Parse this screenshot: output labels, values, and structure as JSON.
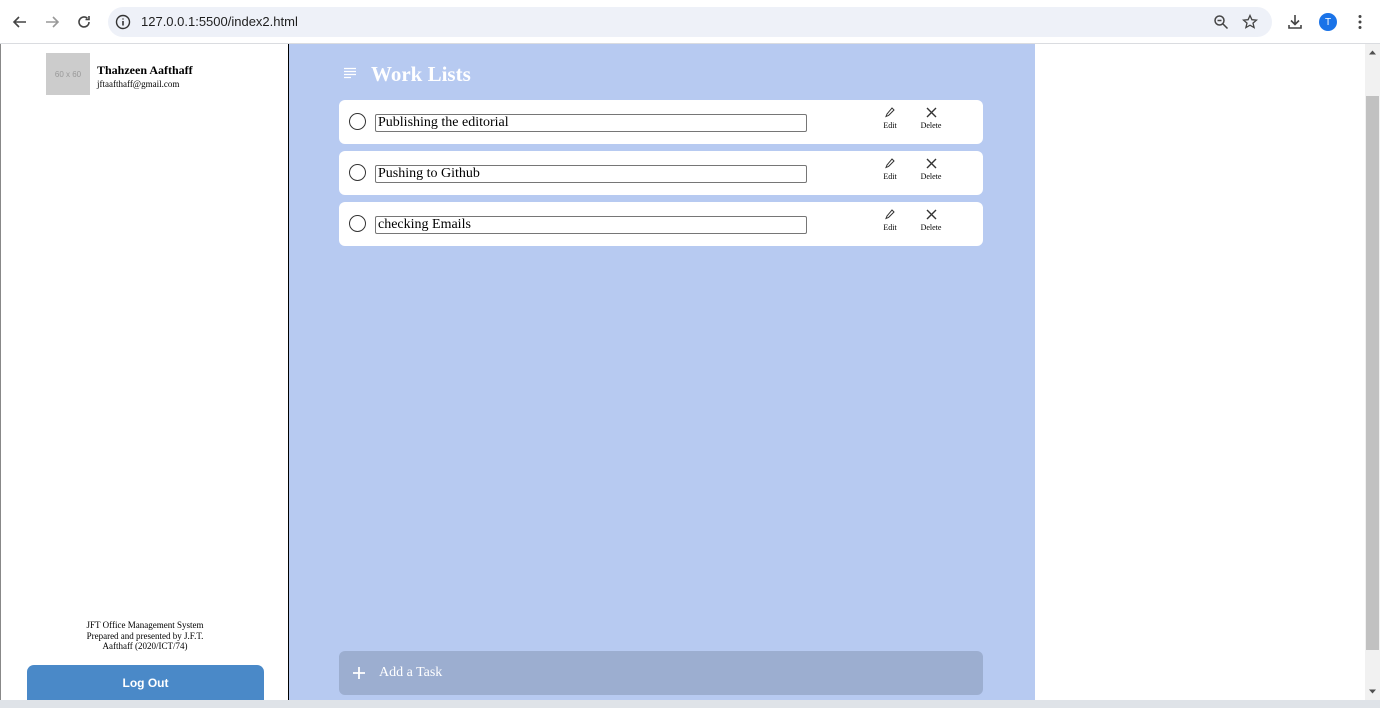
{
  "browser": {
    "url": "127.0.0.1:5500/index2.html",
    "profile_initial": "T"
  },
  "sidebar": {
    "avatar_placeholder": "60 x 60",
    "user_name": "Thahzeen Aafthaff",
    "user_email": "jftaafthaff@gmail.com",
    "footer_line1": "JFT Office Management System",
    "footer_line2": "Prepared and presented by J.F.T.",
    "footer_line3": "Aafthaff (2020/ICT/74)",
    "logout_label": "Log Out"
  },
  "main": {
    "title": "Work Lists",
    "edit_label": "Edit",
    "delete_label": "Delete",
    "tasks": [
      {
        "text": "Publishing the editorial"
      },
      {
        "text": "Pushing to Github"
      },
      {
        "text": "checking Emails"
      }
    ],
    "add_task_label": "Add a Task"
  },
  "colors": {
    "main_bg": "#b7caf1",
    "add_task_bg": "#9caed0",
    "logout_bg": "#4a89c8"
  }
}
